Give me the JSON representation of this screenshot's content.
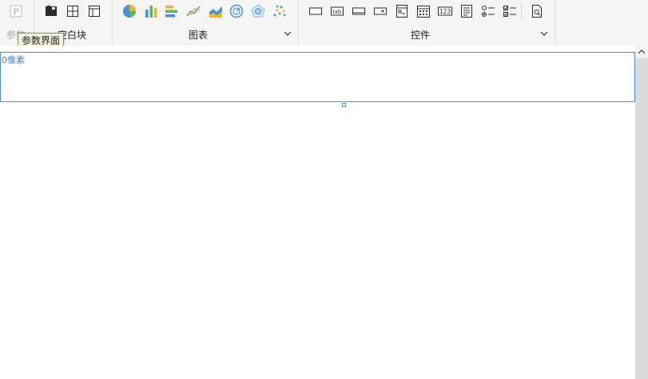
{
  "toolbar": {
    "groups": {
      "param": {
        "label": "参数"
      },
      "blank": {
        "label": "空白块"
      },
      "chart": {
        "label": "图表"
      },
      "widget": {
        "label": "控件"
      }
    },
    "tooltip": "参数界面",
    "widget_icon_text": {
      "label_box": "lab",
      "number": "123"
    }
  },
  "canvas": {
    "param_panel_size": "0像素"
  },
  "colors": {
    "accent": "#4a90d9",
    "pie": [
      "#4a90d9",
      "#f5b324",
      "#5cb85c"
    ],
    "bar": [
      "#4a90d9",
      "#5cb85c",
      "#f5b324"
    ]
  }
}
